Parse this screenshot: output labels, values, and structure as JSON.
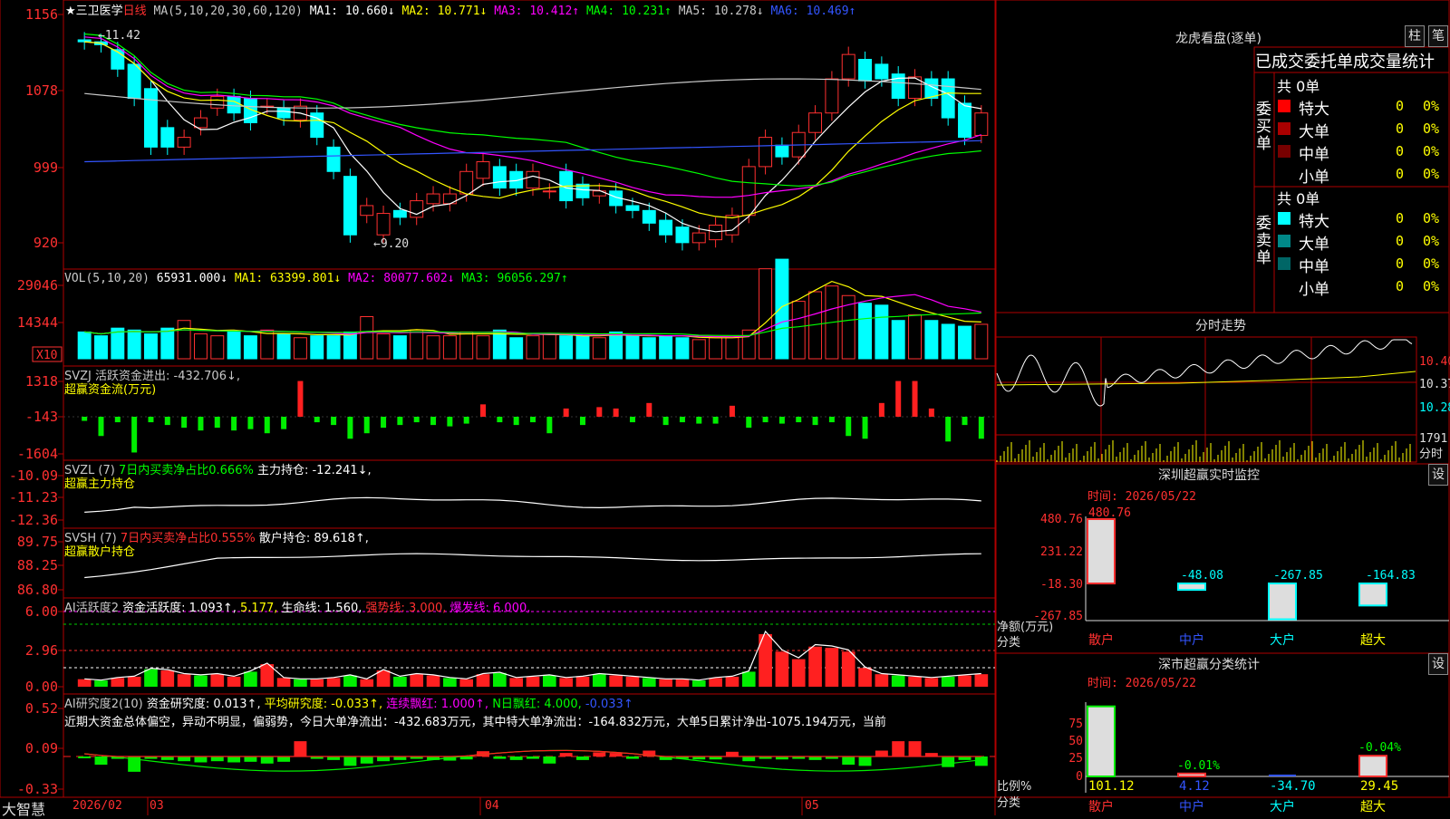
{
  "stock": {
    "title": "★三卫医学",
    "period": "日线"
  },
  "panels": {
    "kline": {
      "header": [
        {
          "t": "MA(5,10,20,30,60,120)",
          "c": "#c8c8c8"
        },
        {
          "t": "MA1: 10.660↓",
          "c": "#ffffff"
        },
        {
          "t": "MA2: 10.771↓",
          "c": "#ffff00"
        },
        {
          "t": "MA3: 10.412↑",
          "c": "#ff00ff"
        },
        {
          "t": "MA4: 10.231↑",
          "c": "#00ff00"
        },
        {
          "t": "MA5: 10.278↓",
          "c": "#c8c8c8"
        },
        {
          "t": "MA6: 10.469↑",
          "c": "#3355ff"
        }
      ],
      "y_ticks": [
        "1156",
        "1078",
        "999",
        "920"
      ],
      "high_label": "←11.42",
      "low_label": "←9.20"
    },
    "vol": {
      "header": [
        {
          "t": "VOL(5,10,20)",
          "c": "#c8c8c8"
        },
        {
          "t": "65931.000↓",
          "c": "#ffffff"
        },
        {
          "t": "MA1: 63399.801↓",
          "c": "#ffff00"
        },
        {
          "t": "MA2: 80077.602↓",
          "c": "#ff00ff"
        },
        {
          "t": "MA3: 96056.297↑",
          "c": "#00ff00"
        }
      ],
      "y_ticks": [
        "29046",
        "14344"
      ],
      "unit": "X10"
    },
    "svzj": {
      "header": [
        {
          "t": "SVZJ  活跃资金进出: -432.706↓,",
          "c": "#c8c8c8"
        }
      ],
      "subtitle": "超赢资金流(万元)",
      "y_ticks": [
        "1318",
        "-143",
        "-1604"
      ]
    },
    "svzl": {
      "header": [
        {
          "t": "SVZL (7)",
          "c": "#c8c8c8"
        },
        {
          "t": "7日内买卖净占比0.666%",
          "c": "#00ff00"
        },
        {
          "t": "主力持仓: -12.241↓,",
          "c": "#ffffff"
        }
      ],
      "subtitle": "超赢主力持仓",
      "y_ticks": [
        "-10.09",
        "-11.23",
        "-12.36"
      ]
    },
    "svsh": {
      "header": [
        {
          "t": "SVSH (7)",
          "c": "#c8c8c8"
        },
        {
          "t": "7日内买卖净占比0.555%",
          "c": "#ff3030"
        },
        {
          "t": "散户持仓: 89.618↑,",
          "c": "#ffffff"
        }
      ],
      "subtitle": "超赢散户持仓",
      "y_ticks": [
        "89.75",
        "88.25",
        "86.80"
      ]
    },
    "ai1": {
      "header": [
        {
          "t": "AI活跃度2",
          "c": "#c8c8c8"
        },
        {
          "t": "资金活跃度: 1.093↑,",
          "c": "#ffffff"
        },
        {
          "t": "5.177,",
          "c": "#ffff00"
        },
        {
          "t": "生命线: 1.560,",
          "c": "#ffffff"
        },
        {
          "t": "强势线: 3.000,",
          "c": "#ff3030"
        },
        {
          "t": "爆发线: 6.000,",
          "c": "#ff00ff"
        }
      ],
      "y_ticks": [
        "6.00",
        "2.96",
        "0.00"
      ]
    },
    "ai2": {
      "header": [
        {
          "t": "AI研究度2(10)",
          "c": "#c8c8c8"
        },
        {
          "t": "资金研究度: 0.013↑,",
          "c": "#ffffff"
        },
        {
          "t": "平均研究度: -0.033↑,",
          "c": "#ffff00"
        },
        {
          "t": "连续飘红: 1.000↑,",
          "c": "#ff00ff"
        },
        {
          "t": "N日飘红: 4.000,",
          "c": "#00ff00"
        },
        {
          "t": "-0.033↑",
          "c": "#3355ff"
        }
      ],
      "text": "近期大资金总体偏空，异动不明显，偏弱势，今日大单净流出：-432.683万元，其中特大单净流出：-164.832万元，大单5日累计净出-1075.194万元，当前",
      "y_ticks": [
        "0.52",
        "0.09",
        "-0.33"
      ]
    }
  },
  "bottom_axis": {
    "brand": "大智慧",
    "labels": [
      "2026/02",
      "03",
      "04",
      "05"
    ]
  },
  "right": {
    "dragon": {
      "title": "龙虎看盘(逐单)",
      "btn1": "柱",
      "btn2": "笔",
      "header": "已成交委托单成交量统计",
      "buy": {
        "label": "委买单",
        "total": "共 0单",
        "rows": [
          {
            "n": "特大",
            "v": "0",
            "p": "0%",
            "c": "#ff0000"
          },
          {
            "n": "大单",
            "v": "0",
            "p": "0%",
            "c": "#aa0000"
          },
          {
            "n": "中单",
            "v": "0",
            "p": "0%",
            "c": "#770000"
          },
          {
            "n": "小单",
            "v": "0",
            "p": "0%",
            "c": "#000000"
          }
        ]
      },
      "sell": {
        "label": "委卖单",
        "total": "共 0单",
        "rows": [
          {
            "n": "特大",
            "v": "0",
            "p": "0%",
            "c": "#00ffff"
          },
          {
            "n": "大单",
            "v": "0",
            "p": "0%",
            "c": "#008888"
          },
          {
            "n": "中单",
            "v": "0",
            "p": "0%",
            "c": "#006666"
          },
          {
            "n": "小单",
            "v": "0",
            "p": "0%",
            "c": "#000000"
          }
        ]
      }
    },
    "intraday": {
      "title": "分时走势",
      "y_ticks": [
        "10.40",
        "10.37",
        "10.28"
      ],
      "vol_tick": "1791",
      "unit": "分时"
    },
    "sz_monitor": {
      "title": "深圳超赢实时监控",
      "btn": "设",
      "time": "时间: 2026/05/22",
      "y_ticks": [
        "480.76",
        "231.22",
        "-18.30",
        "-267.85"
      ],
      "ylabel": "净额(万元)",
      "xlabel": "分类",
      "bars": [
        {
          "cat": "散户",
          "value": 480.76
        },
        {
          "cat": "中户",
          "value": -48.08
        },
        {
          "cat": "大户",
          "value": -267.85
        },
        {
          "cat": "超大",
          "value": -164.83
        }
      ]
    },
    "sh_stats": {
      "title": "深市超赢分类统计",
      "btn": "设",
      "time": "时间: 2026/05/22",
      "y_ticks": [
        "75",
        "50",
        "25",
        "0"
      ],
      "ylabel": "比例%",
      "xlabel": "分类",
      "bars": [
        {
          "cat": "散户",
          "value": 101.12,
          "top": ""
        },
        {
          "cat": "中户",
          "value": 4.12,
          "top": "-0.01%"
        },
        {
          "cat": "大户",
          "value": -34.7,
          "top": ""
        },
        {
          "cat": "超大",
          "value": 29.45,
          "top": "-0.04%"
        }
      ]
    }
  },
  "chart_data": [
    {
      "type": "candlestick",
      "title": "三卫医学 日线",
      "x": [
        "2026-02",
        "2026-03",
        "2026-04",
        "2026-05"
      ],
      "open": [
        11.3,
        11.28,
        11.2,
        11.05,
        10.8,
        10.4,
        10.2,
        10.4,
        10.6,
        10.72,
        10.7,
        10.62,
        10.6,
        10.48,
        10.55,
        10.2,
        9.9,
        9.5,
        9.3,
        9.55,
        9.48,
        9.62,
        9.62,
        9.72,
        9.88,
        10.0,
        9.95,
        9.78,
        9.75,
        9.95,
        9.82,
        9.7,
        9.75,
        9.6,
        9.55,
        9.45,
        9.38,
        9.22,
        9.25,
        9.3,
        9.5,
        10.0,
        10.22,
        10.1,
        10.35,
        10.55,
        10.9,
        11.1,
        11.05,
        10.95,
        10.7,
        10.9,
        10.9,
        10.65,
        10.32
      ],
      "close": [
        11.28,
        11.25,
        11.0,
        10.7,
        10.2,
        10.2,
        10.3,
        10.5,
        10.72,
        10.55,
        10.45,
        10.62,
        10.5,
        10.62,
        10.3,
        9.95,
        9.3,
        9.6,
        9.52,
        9.48,
        9.65,
        9.72,
        9.72,
        9.95,
        10.05,
        9.78,
        9.78,
        9.95,
        9.75,
        9.65,
        9.68,
        9.75,
        9.6,
        9.55,
        9.42,
        9.3,
        9.22,
        9.32,
        9.4,
        9.5,
        10.0,
        10.3,
        10.1,
        10.35,
        10.55,
        10.9,
        11.15,
        10.88,
        10.9,
        10.7,
        10.92,
        10.7,
        10.5,
        10.3,
        10.55
      ],
      "ylim": [
        9.2,
        11.56
      ]
    },
    {
      "type": "bar",
      "title": "VOL(5,10,20)",
      "ylim": [
        0,
        44000
      ],
      "values": [
        14000,
        12000,
        16000,
        15000,
        13000,
        16000,
        20000,
        13000,
        12000,
        14000,
        12000,
        15000,
        13000,
        11000,
        12000,
        12000,
        14000,
        22000,
        13000,
        12000,
        15000,
        12000,
        12000,
        14000,
        12000,
        15000,
        11000,
        12000,
        13000,
        12000,
        12000,
        11000,
        14000,
        12000,
        11000,
        12000,
        11000,
        10000,
        11000,
        11000,
        15000,
        47000,
        52000,
        30000,
        35000,
        38000,
        33000,
        29000,
        28000,
        20000,
        23000,
        20000,
        18000,
        17000,
        18000
      ]
    },
    {
      "type": "bar",
      "title": "超赢资金流(万元)",
      "ylim": [
        -1604,
        1318
      ],
      "values": [
        -150,
        -700,
        -200,
        -1300,
        -200,
        -300,
        -400,
        -500,
        -400,
        -500,
        -450,
        -600,
        -450,
        1300,
        -200,
        -300,
        -800,
        -600,
        -400,
        -300,
        -200,
        -300,
        -350,
        -250,
        450,
        -200,
        -300,
        -200,
        -600,
        300,
        -300,
        350,
        300,
        -200,
        500,
        -300,
        -200,
        -250,
        -250,
        400,
        -400,
        -200,
        -250,
        -200,
        -300,
        -200,
        -700,
        -800,
        500,
        1300,
        1300,
        300,
        -900,
        -300,
        -800
      ]
    }
  ]
}
